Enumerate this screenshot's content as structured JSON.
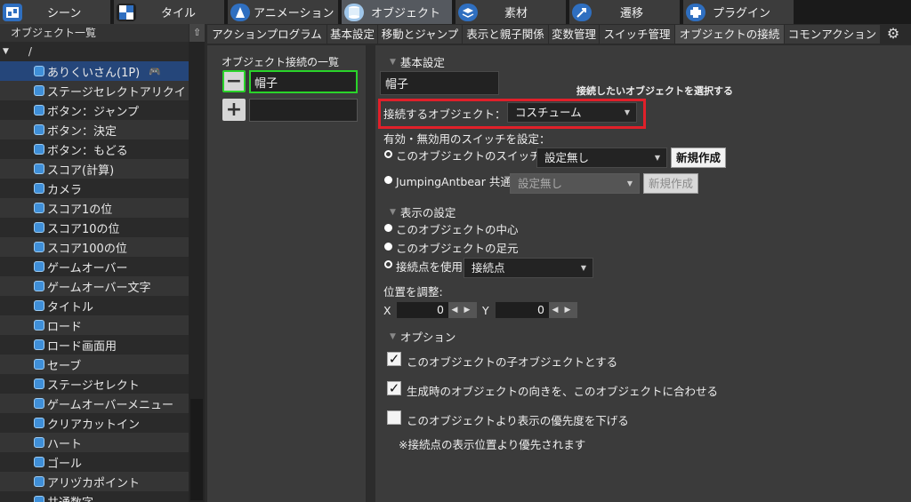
{
  "top_tabs": [
    {
      "label": "シーン",
      "icon": "scene-icon"
    },
    {
      "label": "タイル",
      "icon": "tile-icon"
    },
    {
      "label": "アニメーション",
      "icon": "animation-icon"
    },
    {
      "label": "オブジェクト",
      "icon": "object-icon"
    },
    {
      "label": "素材",
      "icon": "resource-icon"
    },
    {
      "label": "遷移",
      "icon": "transition-icon"
    },
    {
      "label": "プラグイン",
      "icon": "plugin-icon"
    }
  ],
  "left_panel": {
    "title": "オブジェクト一覧",
    "up_glyph": "⇧",
    "root_label": "/",
    "items": [
      {
        "label": "ありくいさん(1P)"
      },
      {
        "label": "ステージセレクトアリクイ"
      },
      {
        "label": "ボタン：ジャンプ"
      },
      {
        "label": "ボタン：決定"
      },
      {
        "label": "ボタン：もどる"
      },
      {
        "label": "スコア(計算)"
      },
      {
        "label": "カメラ"
      },
      {
        "label": "スコア1の位"
      },
      {
        "label": "スコア10の位"
      },
      {
        "label": "スコア100の位"
      },
      {
        "label": "ゲームオーバー"
      },
      {
        "label": "ゲームオーバー文字"
      },
      {
        "label": "タイトル"
      },
      {
        "label": "ロード"
      },
      {
        "label": "ロード画面用"
      },
      {
        "label": "セーブ"
      },
      {
        "label": "ステージセレクト"
      },
      {
        "label": "ゲームオーバーメニュー"
      },
      {
        "label": "クリアカットイン"
      },
      {
        "label": "ハート"
      },
      {
        "label": "ゴール"
      },
      {
        "label": "アリヅカポイント"
      },
      {
        "label": "共通数字"
      }
    ],
    "selected_index": 0
  },
  "sub_tabs": [
    {
      "label": "アクションプログラム"
    },
    {
      "label": "基本設定"
    },
    {
      "label": "移動とジャンプ"
    },
    {
      "label": "表示と親子関係"
    },
    {
      "label": "変数管理"
    },
    {
      "label": "スイッチ管理"
    },
    {
      "label": "オブジェクトの接続"
    },
    {
      "label": "コモンアクション"
    }
  ],
  "active_sub_tab": "オブジェクトの接続",
  "connection_list": {
    "title": "オブジェクト接続の一覧",
    "items": [
      "帽子",
      ""
    ],
    "minus": "−",
    "plus": "+"
  },
  "basic": {
    "header": "基本設定",
    "name": "帽子",
    "hint": "接続したいオブジェクトを選択する",
    "target_label": "接続するオブジェクト：",
    "target_value": "コスチューム",
    "switch_label": "有効・無効用のスイッチを設定：",
    "this_switch_label": "このオブジェクトのスイッチ",
    "this_switch_value": "設定無し",
    "new_button": "新規作成",
    "common_switch_label": "JumpingAntbear 共通",
    "common_switch_value": "設定無し",
    "common_new_button": "新規作成"
  },
  "display": {
    "header": "表示の設定",
    "opt_center": "このオブジェクトの中心",
    "opt_foot": "このオブジェクトの足元",
    "opt_point": "接続点を使用",
    "point_value": "接続点",
    "adjust_label": "位置を調整:",
    "x_label": "X",
    "x_value": "0",
    "y_label": "Y",
    "y_value": "0"
  },
  "options": {
    "header": "オプション",
    "cb1": "このオブジェクトの子オブジェクトとする",
    "cb1_checked": true,
    "cb2": "生成時のオブジェクトの向きを、このオブジェクトに合わせる",
    "cb2_checked": true,
    "cb3": "このオブジェクトより表示の優先度を下げる",
    "cb3_checked": false,
    "note": "※接続点の表示位置より優先されます"
  },
  "colors": {
    "selection": "#25467a",
    "highlight_box": "#e0202a",
    "active_border": "#2ad42a",
    "icon_blue": "#3f8fd8"
  }
}
